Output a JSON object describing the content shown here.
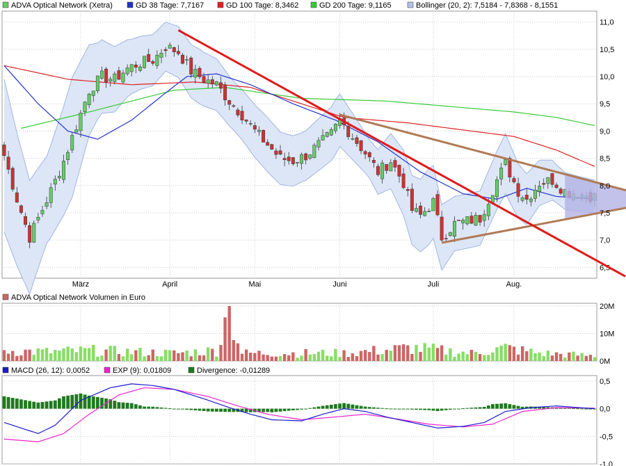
{
  "colors": {
    "up": "#66cc66",
    "down": "#cc3333",
    "ma38": "#2233cc",
    "ma100": "#dd2222",
    "ma200": "#33cc33",
    "bollinger_fill": "#dde6f6",
    "bollinger_line": "#9fb6e0",
    "trend_red": "#e01919",
    "trend_brown": "#b07a55",
    "triangle_fill": "#b3b3e6",
    "vol_up": "#88dd66",
    "vol_down": "#cc6666",
    "macd": "#1a1acc",
    "exp": "#ee22cc",
    "divergence": "#1f7a1f",
    "grid": "#cccccc"
  },
  "price_panel": {
    "legend": [
      {
        "label": "ADVA Optical Network (Xetra)",
        "swatch": "#66cc66"
      },
      {
        "label": "GD 38 Tage: 7,7167",
        "swatch": "#2233cc"
      },
      {
        "label": "GD 100 Tage: 8,3462",
        "swatch": "#dd2222"
      },
      {
        "label": "GD 200 Tage: 9,1165",
        "swatch": "#33cc33"
      },
      {
        "label": "Bollinger (20, 2): 7,5184 - 7,8368 - 8,1551",
        "swatch": "#b3c3e6"
      }
    ],
    "y_ticks": [
      "11,0",
      "10,5",
      "10,0",
      "9,5",
      "9,0",
      "8,5",
      "8,0",
      "7,5",
      "7,0",
      "6,5"
    ],
    "x_labels": [
      "März",
      "April",
      "Mai",
      "Juni",
      "Juli",
      "Aug."
    ]
  },
  "volume_panel": {
    "legend": "ADVA Optical Network Volumen in Euro",
    "y_ticks": [
      "20M",
      "10M",
      "0M"
    ]
  },
  "macd_panel": {
    "legend": [
      {
        "label": "MACD (26, 12): 0,0052",
        "swatch": "#1a1acc"
      },
      {
        "label": "EXP (9): 0,01809",
        "swatch": "#ee22cc"
      },
      {
        "label": "Divergence: -0,01289",
        "swatch": "#1f7a1f"
      }
    ],
    "y_ticks": [
      "0,5",
      "0,0",
      "-0,5",
      "-1,0"
    ]
  },
  "chart_data": {
    "type": "candlestick",
    "trading_days": 140,
    "price_ylim": [
      6.3,
      11.2
    ],
    "month_starts": {
      "März": 18,
      "April": 39,
      "Mai": 59,
      "Juni": 79,
      "Juli": 101,
      "Aug.": 120
    },
    "price_anchors": [
      [
        0,
        8.55
      ],
      [
        3,
        7.75
      ],
      [
        6,
        7.05
      ],
      [
        8,
        7.4
      ],
      [
        11,
        7.9
      ],
      [
        14,
        8.45
      ],
      [
        17,
        9.1
      ],
      [
        20,
        9.75
      ],
      [
        23,
        10.0
      ],
      [
        26,
        9.95
      ],
      [
        29,
        10.15
      ],
      [
        32,
        10.25
      ],
      [
        35,
        10.3
      ],
      [
        38,
        10.55
      ],
      [
        41,
        10.45
      ],
      [
        44,
        10.1
      ],
      [
        47,
        9.95
      ],
      [
        50,
        9.85
      ],
      [
        53,
        9.55
      ],
      [
        56,
        9.3
      ],
      [
        59,
        9.0
      ],
      [
        62,
        8.75
      ],
      [
        65,
        8.5
      ],
      [
        68,
        8.45
      ],
      [
        71,
        8.55
      ],
      [
        74,
        8.75
      ],
      [
        77,
        8.95
      ],
      [
        79,
        9.2
      ],
      [
        82,
        8.9
      ],
      [
        85,
        8.6
      ],
      [
        88,
        8.25
      ],
      [
        91,
        8.45
      ],
      [
        94,
        8.05
      ],
      [
        96,
        7.55
      ],
      [
        98,
        7.45
      ],
      [
        101,
        7.7
      ],
      [
        103,
        7.05
      ],
      [
        106,
        7.3
      ],
      [
        109,
        7.35
      ],
      [
        112,
        7.4
      ],
      [
        114,
        7.75
      ],
      [
        116,
        8.1
      ],
      [
        118,
        8.4
      ],
      [
        121,
        7.9
      ],
      [
        123,
        7.75
      ],
      [
        126,
        8.05
      ],
      [
        129,
        8.1
      ],
      [
        132,
        7.9
      ],
      [
        135,
        7.85
      ],
      [
        139,
        7.8
      ]
    ],
    "ma38_anchors": [
      [
        0,
        10.2
      ],
      [
        8,
        9.5
      ],
      [
        15,
        9.0
      ],
      [
        22,
        8.85
      ],
      [
        30,
        9.2
      ],
      [
        38,
        9.7
      ],
      [
        43,
        10.0
      ],
      [
        50,
        10.05
      ],
      [
        58,
        9.85
      ],
      [
        68,
        9.5
      ],
      [
        78,
        9.2
      ],
      [
        88,
        8.8
      ],
      [
        98,
        8.25
      ],
      [
        108,
        7.85
      ],
      [
        116,
        7.75
      ],
      [
        123,
        7.95
      ],
      [
        130,
        7.8
      ],
      [
        139,
        7.75
      ]
    ],
    "ma100_anchors": [
      [
        0,
        10.2
      ],
      [
        15,
        9.95
      ],
      [
        30,
        9.85
      ],
      [
        45,
        9.9
      ],
      [
        58,
        9.8
      ],
      [
        68,
        9.55
      ],
      [
        80,
        9.25
      ],
      [
        95,
        9.15
      ],
      [
        110,
        9.0
      ],
      [
        120,
        8.9
      ],
      [
        130,
        8.65
      ],
      [
        139,
        8.35
      ]
    ],
    "ma200_anchors": [
      [
        4,
        9.05
      ],
      [
        20,
        9.35
      ],
      [
        40,
        9.75
      ],
      [
        52,
        9.8
      ],
      [
        70,
        9.6
      ],
      [
        90,
        9.55
      ],
      [
        105,
        9.45
      ],
      [
        120,
        9.35
      ],
      [
        130,
        9.25
      ],
      [
        139,
        9.1
      ]
    ],
    "bollinger_width_anchors": [
      [
        0,
        1.4
      ],
      [
        5,
        1.1
      ],
      [
        10,
        0.8
      ],
      [
        16,
        1.1
      ],
      [
        22,
        0.7
      ],
      [
        30,
        0.5
      ],
      [
        38,
        0.45
      ],
      [
        46,
        0.5
      ],
      [
        54,
        0.45
      ],
      [
        62,
        0.5
      ],
      [
        70,
        0.45
      ],
      [
        78,
        0.5
      ],
      [
        86,
        0.35
      ],
      [
        94,
        0.6
      ],
      [
        100,
        0.7
      ],
      [
        106,
        0.5
      ],
      [
        112,
        0.5
      ],
      [
        118,
        0.55
      ],
      [
        124,
        0.45
      ],
      [
        130,
        0.35
      ],
      [
        139,
        0.3
      ]
    ],
    "volume_anchors": [
      [
        0,
        4
      ],
      [
        10,
        3.5
      ],
      [
        20,
        4
      ],
      [
        30,
        3.5
      ],
      [
        40,
        3
      ],
      [
        50,
        4
      ],
      [
        53,
        20
      ],
      [
        56,
        3
      ],
      [
        70,
        3
      ],
      [
        80,
        3
      ],
      [
        96,
        5
      ],
      [
        110,
        3
      ],
      [
        118,
        5
      ],
      [
        126,
        3
      ],
      [
        139,
        2
      ]
    ],
    "volume_ylim": [
      0,
      20
    ],
    "macd_ylim": [
      -1.0,
      0.6
    ],
    "macd_anchors": [
      [
        0,
        -0.25
      ],
      [
        8,
        -0.45
      ],
      [
        12,
        -0.3
      ],
      [
        18,
        0.15
      ],
      [
        25,
        0.38
      ],
      [
        30,
        0.45
      ],
      [
        35,
        0.42
      ],
      [
        40,
        0.35
      ],
      [
        47,
        0.18
      ],
      [
        53,
        0.02
      ],
      [
        58,
        -0.1
      ],
      [
        63,
        -0.2
      ],
      [
        70,
        -0.22
      ],
      [
        75,
        -0.1
      ],
      [
        80,
        0.0
      ],
      [
        85,
        -0.05
      ],
      [
        90,
        -0.15
      ],
      [
        96,
        -0.25
      ],
      [
        102,
        -0.35
      ],
      [
        108,
        -0.32
      ],
      [
        113,
        -0.25
      ],
      [
        118,
        -0.05
      ],
      [
        124,
        0.02
      ],
      [
        130,
        0.05
      ],
      [
        139,
        0.0
      ]
    ],
    "exp_anchors": [
      [
        0,
        -0.55
      ],
      [
        8,
        -0.6
      ],
      [
        14,
        -0.45
      ],
      [
        20,
        -0.1
      ],
      [
        27,
        0.25
      ],
      [
        33,
        0.38
      ],
      [
        40,
        0.35
      ],
      [
        48,
        0.22
      ],
      [
        55,
        0.05
      ],
      [
        62,
        -0.1
      ],
      [
        70,
        -0.2
      ],
      [
        78,
        -0.15
      ],
      [
        85,
        -0.1
      ],
      [
        92,
        -0.18
      ],
      [
        100,
        -0.28
      ],
      [
        108,
        -0.33
      ],
      [
        115,
        -0.28
      ],
      [
        122,
        -0.05
      ],
      [
        130,
        0.02
      ],
      [
        139,
        0.01
      ]
    ],
    "trendlines": [
      {
        "name": "downtrend",
        "from": [
          41,
          10.85
        ],
        "to": [
          147,
          6.3
        ]
      },
      {
        "name": "upper_wedge",
        "from": [
          79,
          9.3
        ],
        "to": [
          147,
          7.9
        ]
      },
      {
        "name": "lower_wedge",
        "from": [
          103,
          6.95
        ],
        "to": [
          147,
          7.6
        ]
      }
    ],
    "last_values": {
      "ma38": "7,7167",
      "ma100": "8,3462",
      "ma200": "9,1165",
      "bollinger": "7,5184 - 7,8368 - 8,1551",
      "macd": "0,0052",
      "exp": "0,01809",
      "divergence": "-0,01289"
    }
  }
}
